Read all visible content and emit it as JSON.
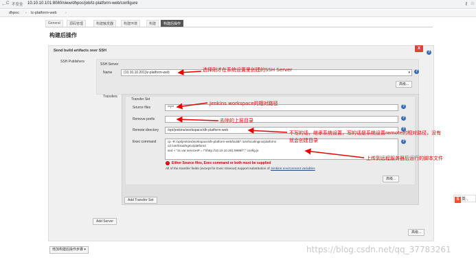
{
  "browser": {
    "back": "←",
    "forward": "→",
    "reload": "C",
    "security": "不安全",
    "url": "10.10.10.101:8080/view/dhpoc/job/lz-platform-web/configure"
  },
  "breadcrumb": {
    "item1": "dhpoc",
    "sep": "›",
    "item2": "lz-platform-web",
    "sep2": "›"
  },
  "tabs": [
    "General",
    "源码管理",
    "构建触发器",
    "构建环境",
    "构建",
    "构建后操作"
  ],
  "page": {
    "section_title": "构建后操作"
  },
  "panel": {
    "title": "Send build artifacts over SSH",
    "delete_label": "X",
    "ssh_publishers_label": "SSH Publishers",
    "ssh_server_label": "SSH Server",
    "name_label": "Name",
    "name_value": "(10.10.10.201)lz-platform-web",
    "advanced_label": "高级...",
    "transfers_label": "Transfers",
    "transfer_set_label": "Transfer Set",
    "source_files_label": "Source files",
    "source_files_value": "**/**",
    "remove_prefix_label": "Remove prefix",
    "remove_prefix_value": "",
    "remote_directory_label": "Remote directory",
    "remote_directory_value": "/opt/jenkins/workspace/dh-platform-web",
    "exec_command_label": "Exec command",
    "exec_command_lines": [
      "cp -R /opt/jenkins/workspace/dh-platform-web/build/* /usr/local/nginx/platform/",
      "cd /usr/local/nginx/platform/",
      "sed -i \"3c var serviceIP = \\\"//http://10.10.10.201:9999/\\\";\" config.js"
    ],
    "error_text": "Either Source files, Exec command or both must be supplied",
    "note_text": "All of the transfer fields (except for Exec timeout) support substitution of",
    "note_link": "Jenkins environment variables",
    "add_transfer_set_label": "Add Transfer Set",
    "add_server_label": "Add Server",
    "help_label": "?"
  },
  "annotations": {
    "name": "选择刚才在系统设置里创建的SSH Server",
    "source": "Jenkins workspace的相对路径",
    "prefix": "去除的上层目录",
    "remote_line1": "不写的话，继承系统设置，写的话是系统设置remote的相对路径，没有",
    "remote_line2": "就会创建目录",
    "exec": "上传到远程服务器后运行的脚本文件"
  },
  "footer": {
    "add_post_build_label": "增加构建后操作步骤",
    "watermark": "https://blog.csdn.net/qq_37783261",
    "badge_text": "英",
    "badge_extra": "·,"
  },
  "colors": {
    "annotation": "#e60000",
    "active_tab": "#555555",
    "delete_button": "#d24939",
    "help": "#3b6fb6"
  }
}
